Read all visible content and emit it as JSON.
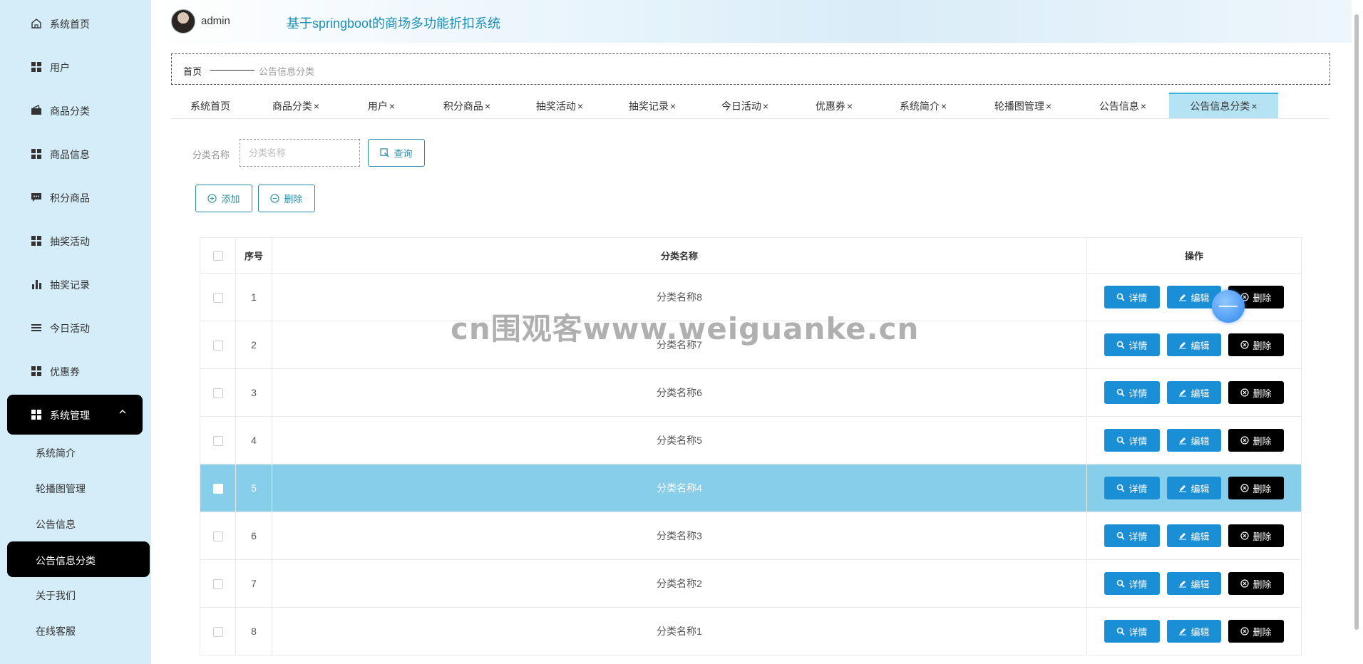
{
  "sidebar": {
    "items": [
      {
        "label": "系统首页",
        "icon": "home-icon"
      },
      {
        "label": "用户",
        "icon": "grid-icon"
      },
      {
        "label": "商品分类",
        "icon": "folder-icon"
      },
      {
        "label": "商品信息",
        "icon": "grid-icon"
      },
      {
        "label": "积分商品",
        "icon": "chat-icon"
      },
      {
        "label": "抽奖活动",
        "icon": "grid-icon"
      },
      {
        "label": "抽奖记录",
        "icon": "bar-chart-icon"
      },
      {
        "label": "今日活动",
        "icon": "list-icon"
      },
      {
        "label": "优惠券",
        "icon": "grid-icon"
      },
      {
        "label": "系统管理",
        "icon": "grid-icon"
      }
    ],
    "sub_items": [
      {
        "label": "系统简介"
      },
      {
        "label": "轮播图管理"
      },
      {
        "label": "公告信息"
      },
      {
        "label": "公告信息分类"
      },
      {
        "label": "关于我们"
      },
      {
        "label": "在线客服"
      }
    ]
  },
  "header": {
    "username": "admin",
    "title": "基于springboot的商场多功能折扣系统"
  },
  "breadcrumb": {
    "home": "首页",
    "current": "公告信息分类"
  },
  "tabs": [
    {
      "label": "系统首页",
      "closable": ""
    },
    {
      "label": "商品分类",
      "closable": "×"
    },
    {
      "label": "用户",
      "closable": "×"
    },
    {
      "label": "积分商品",
      "closable": "×"
    },
    {
      "label": "抽奖活动",
      "closable": "×"
    },
    {
      "label": "抽奖记录",
      "closable": "×"
    },
    {
      "label": "今日活动",
      "closable": "×"
    },
    {
      "label": "优惠券",
      "closable": "×"
    },
    {
      "label": "系统简介",
      "closable": "×"
    },
    {
      "label": "轮播图管理",
      "closable": "×"
    },
    {
      "label": "公告信息",
      "closable": "×"
    },
    {
      "label": "公告信息分类",
      "closable": "×"
    }
  ],
  "search": {
    "label": "分类名称",
    "placeholder": "分类名称",
    "query_label": "查询"
  },
  "actions": {
    "add_label": "添加",
    "delete_label": "删除"
  },
  "table": {
    "headers": {
      "index": "序号",
      "name": "分类名称",
      "ops": "操作"
    },
    "rows": [
      {
        "index": "1",
        "name": "分类名称8"
      },
      {
        "index": "2",
        "name": "分类名称7"
      },
      {
        "index": "3",
        "name": "分类名称6"
      },
      {
        "index": "4",
        "name": "分类名称5"
      },
      {
        "index": "5",
        "name": "分类名称4"
      },
      {
        "index": "6",
        "name": "分类名称3"
      },
      {
        "index": "7",
        "name": "分类名称2"
      },
      {
        "index": "8",
        "name": "分类名称1"
      }
    ],
    "op_labels": {
      "detail": "详情",
      "edit": "编辑",
      "delete": "删除"
    }
  },
  "watermark": "cn围观客www.weiguanke.cn",
  "colors": {
    "sidebar_bg": "#d4edf8",
    "active_bg": "#000000",
    "title": "#1a8fb8",
    "primary_button": "#1a8fd6",
    "danger_button": "#000000",
    "selected_row": "#87ceeb"
  }
}
